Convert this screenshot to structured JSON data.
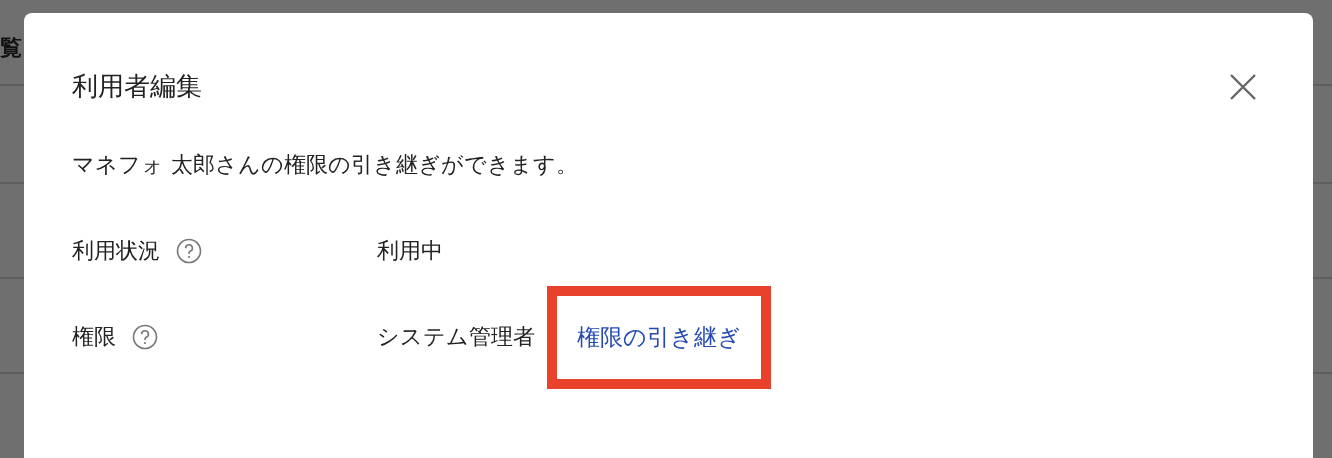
{
  "background": {
    "title_fragment": "覧"
  },
  "dialog": {
    "title": "利用者編集",
    "description": "マネフォ 太郎さんの権限の引き継ぎができます。",
    "fields": [
      {
        "label": "利用状況",
        "value": "利用中"
      },
      {
        "label": "権限",
        "value": "システム管理者",
        "link": {
          "text": "権限の引き継ぎ",
          "highlighted": true
        }
      }
    ]
  }
}
